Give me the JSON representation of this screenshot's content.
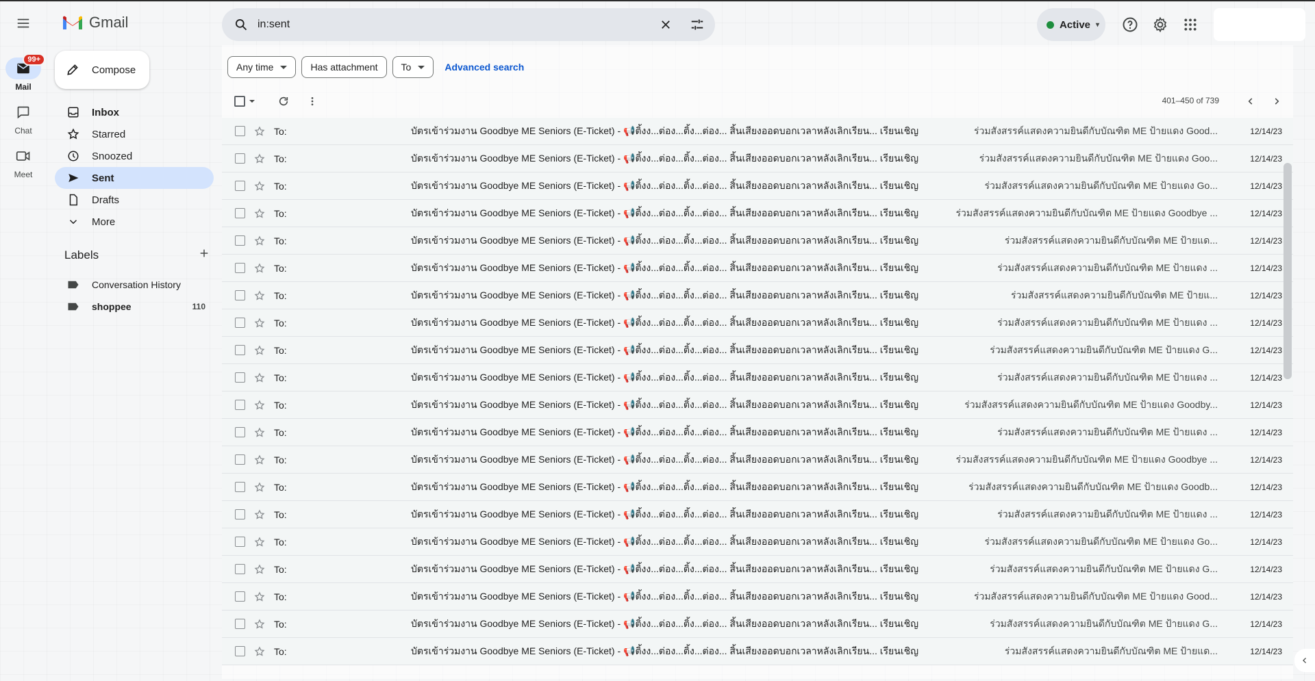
{
  "app": {
    "name": "Gmail"
  },
  "search": {
    "query": "in:sent"
  },
  "status": {
    "label": "Active",
    "color": "#1e8e3e"
  },
  "rail": {
    "items": [
      {
        "label": "Mail",
        "badge": "99+",
        "icon": "mail-icon"
      },
      {
        "label": "Chat",
        "icon": "chat-icon"
      },
      {
        "label": "Meet",
        "icon": "video-icon"
      }
    ]
  },
  "compose": {
    "label": "Compose"
  },
  "nav": {
    "items": [
      {
        "label": "Inbox",
        "icon": "inbox-icon"
      },
      {
        "label": "Starred",
        "icon": "star-icon"
      },
      {
        "label": "Snoozed",
        "icon": "clock-icon"
      },
      {
        "label": "Sent",
        "icon": "send-icon"
      },
      {
        "label": "Drafts",
        "icon": "draft-icon"
      },
      {
        "label": "More",
        "icon": "chevron-down-icon"
      }
    ]
  },
  "labels": {
    "title": "Labels",
    "items": [
      {
        "label": "Conversation History",
        "count": ""
      },
      {
        "label": "shoppee",
        "count": "110"
      }
    ]
  },
  "filters": {
    "any_time": "Any time",
    "has_attachment": "Has attachment",
    "to": "To",
    "advanced": "Advanced search"
  },
  "pager": {
    "text": "401–450 of 739"
  },
  "email_subject": "บัตรเข้าร่วมงาน Goodbye ME Seniors (E-Ticket) - 📢ติ้งง...ต่อง...ติ้ง...ต่อง... สิ้นเสียงออดบอกเวลาหลังเลิกเรียน... เรียนเชิญ",
  "emails": [
    {
      "to": "To:",
      "snippet": "ร่วมสังสรรค์แสดงความยินดีกับบัณฑิต ME ป้ายแดง Good...",
      "date": "12/14/23"
    },
    {
      "to": "To:",
      "snippet": "ร่วมสังสรรค์แสดงความยินดีกับบัณฑิต ME ป้ายแดง Goo...",
      "date": "12/14/23"
    },
    {
      "to": "To:",
      "snippet": "ร่วมสังสรรค์แสดงความยินดีกับบัณฑิต ME ป้ายแดง Go...",
      "date": "12/14/23"
    },
    {
      "to": "To:",
      "snippet": "ร่วมสังสรรค์แสดงความยินดีกับบัณฑิต ME ป้ายแดง Goodbye ...",
      "date": "12/14/23"
    },
    {
      "to": "To:",
      "snippet": "ร่วมสังสรรค์แสดงความยินดีกับบัณฑิต ME ป้ายแด...",
      "date": "12/14/23"
    },
    {
      "to": "To:",
      "snippet": "ร่วมสังสรรค์แสดงความยินดีกับบัณฑิต ME ป้ายแดง ...",
      "date": "12/14/23"
    },
    {
      "to": "To:",
      "snippet": "ร่วมสังสรรค์แสดงความยินดีกับบัณฑิต ME ป้ายแ...",
      "date": "12/14/23"
    },
    {
      "to": "To:",
      "snippet": "ร่วมสังสรรค์แสดงความยินดีกับบัณฑิต ME ป้ายแดง ...",
      "date": "12/14/23"
    },
    {
      "to": "To:",
      "snippet": "ร่วมสังสรรค์แสดงความยินดีกับบัณฑิต ME ป้ายแดง G...",
      "date": "12/14/23"
    },
    {
      "to": "To:",
      "snippet": "ร่วมสังสรรค์แสดงความยินดีกับบัณฑิต ME ป้ายแดง ...",
      "date": "12/14/23"
    },
    {
      "to": "To:",
      "snippet": "ร่วมสังสรรค์แสดงความยินดีกับบัณฑิต ME ป้ายแดง Goodby...",
      "date": "12/14/23"
    },
    {
      "to": "To:",
      "snippet": "ร่วมสังสรรค์แสดงความยินดีกับบัณฑิต ME ป้ายแดง ...",
      "date": "12/14/23"
    },
    {
      "to": "To:",
      "snippet": "ร่วมสังสรรค์แสดงความยินดีกับบัณฑิต ME ป้ายแดง Goodbye ...",
      "date": "12/14/23"
    },
    {
      "to": "To:",
      "snippet": "ร่วมสังสรรค์แสดงความยินดีกับบัณฑิต ME ป้ายแดง Goodb...",
      "date": "12/14/23"
    },
    {
      "to": "To:",
      "snippet": "ร่วมสังสรรค์แสดงความยินดีกับบัณฑิต ME ป้ายแดง ...",
      "date": "12/14/23"
    },
    {
      "to": "To:",
      "snippet": "ร่วมสังสรรค์แสดงความยินดีกับบัณฑิต ME ป้ายแดง Go...",
      "date": "12/14/23"
    },
    {
      "to": "To:",
      "snippet": "ร่วมสังสรรค์แสดงความยินดีกับบัณฑิต ME ป้ายแดง G...",
      "date": "12/14/23"
    },
    {
      "to": "To:",
      "snippet": "ร่วมสังสรรค์แสดงความยินดีกับบัณฑิต ME ป้ายแดง Good...",
      "date": "12/14/23"
    },
    {
      "to": "To:",
      "snippet": "ร่วมสังสรรค์แสดงความยินดีกับบัณฑิต ME ป้ายแดง G...",
      "date": "12/14/23"
    },
    {
      "to": "To:",
      "snippet": "ร่วมสังสรรค์แสดงความยินดีกับบัณฑิต ME ป้ายแด...",
      "date": "12/14/23"
    }
  ],
  "colors": {
    "accent": "#0b57d0",
    "selected_nav": "#d3e3fd",
    "badge": "#d93025"
  }
}
